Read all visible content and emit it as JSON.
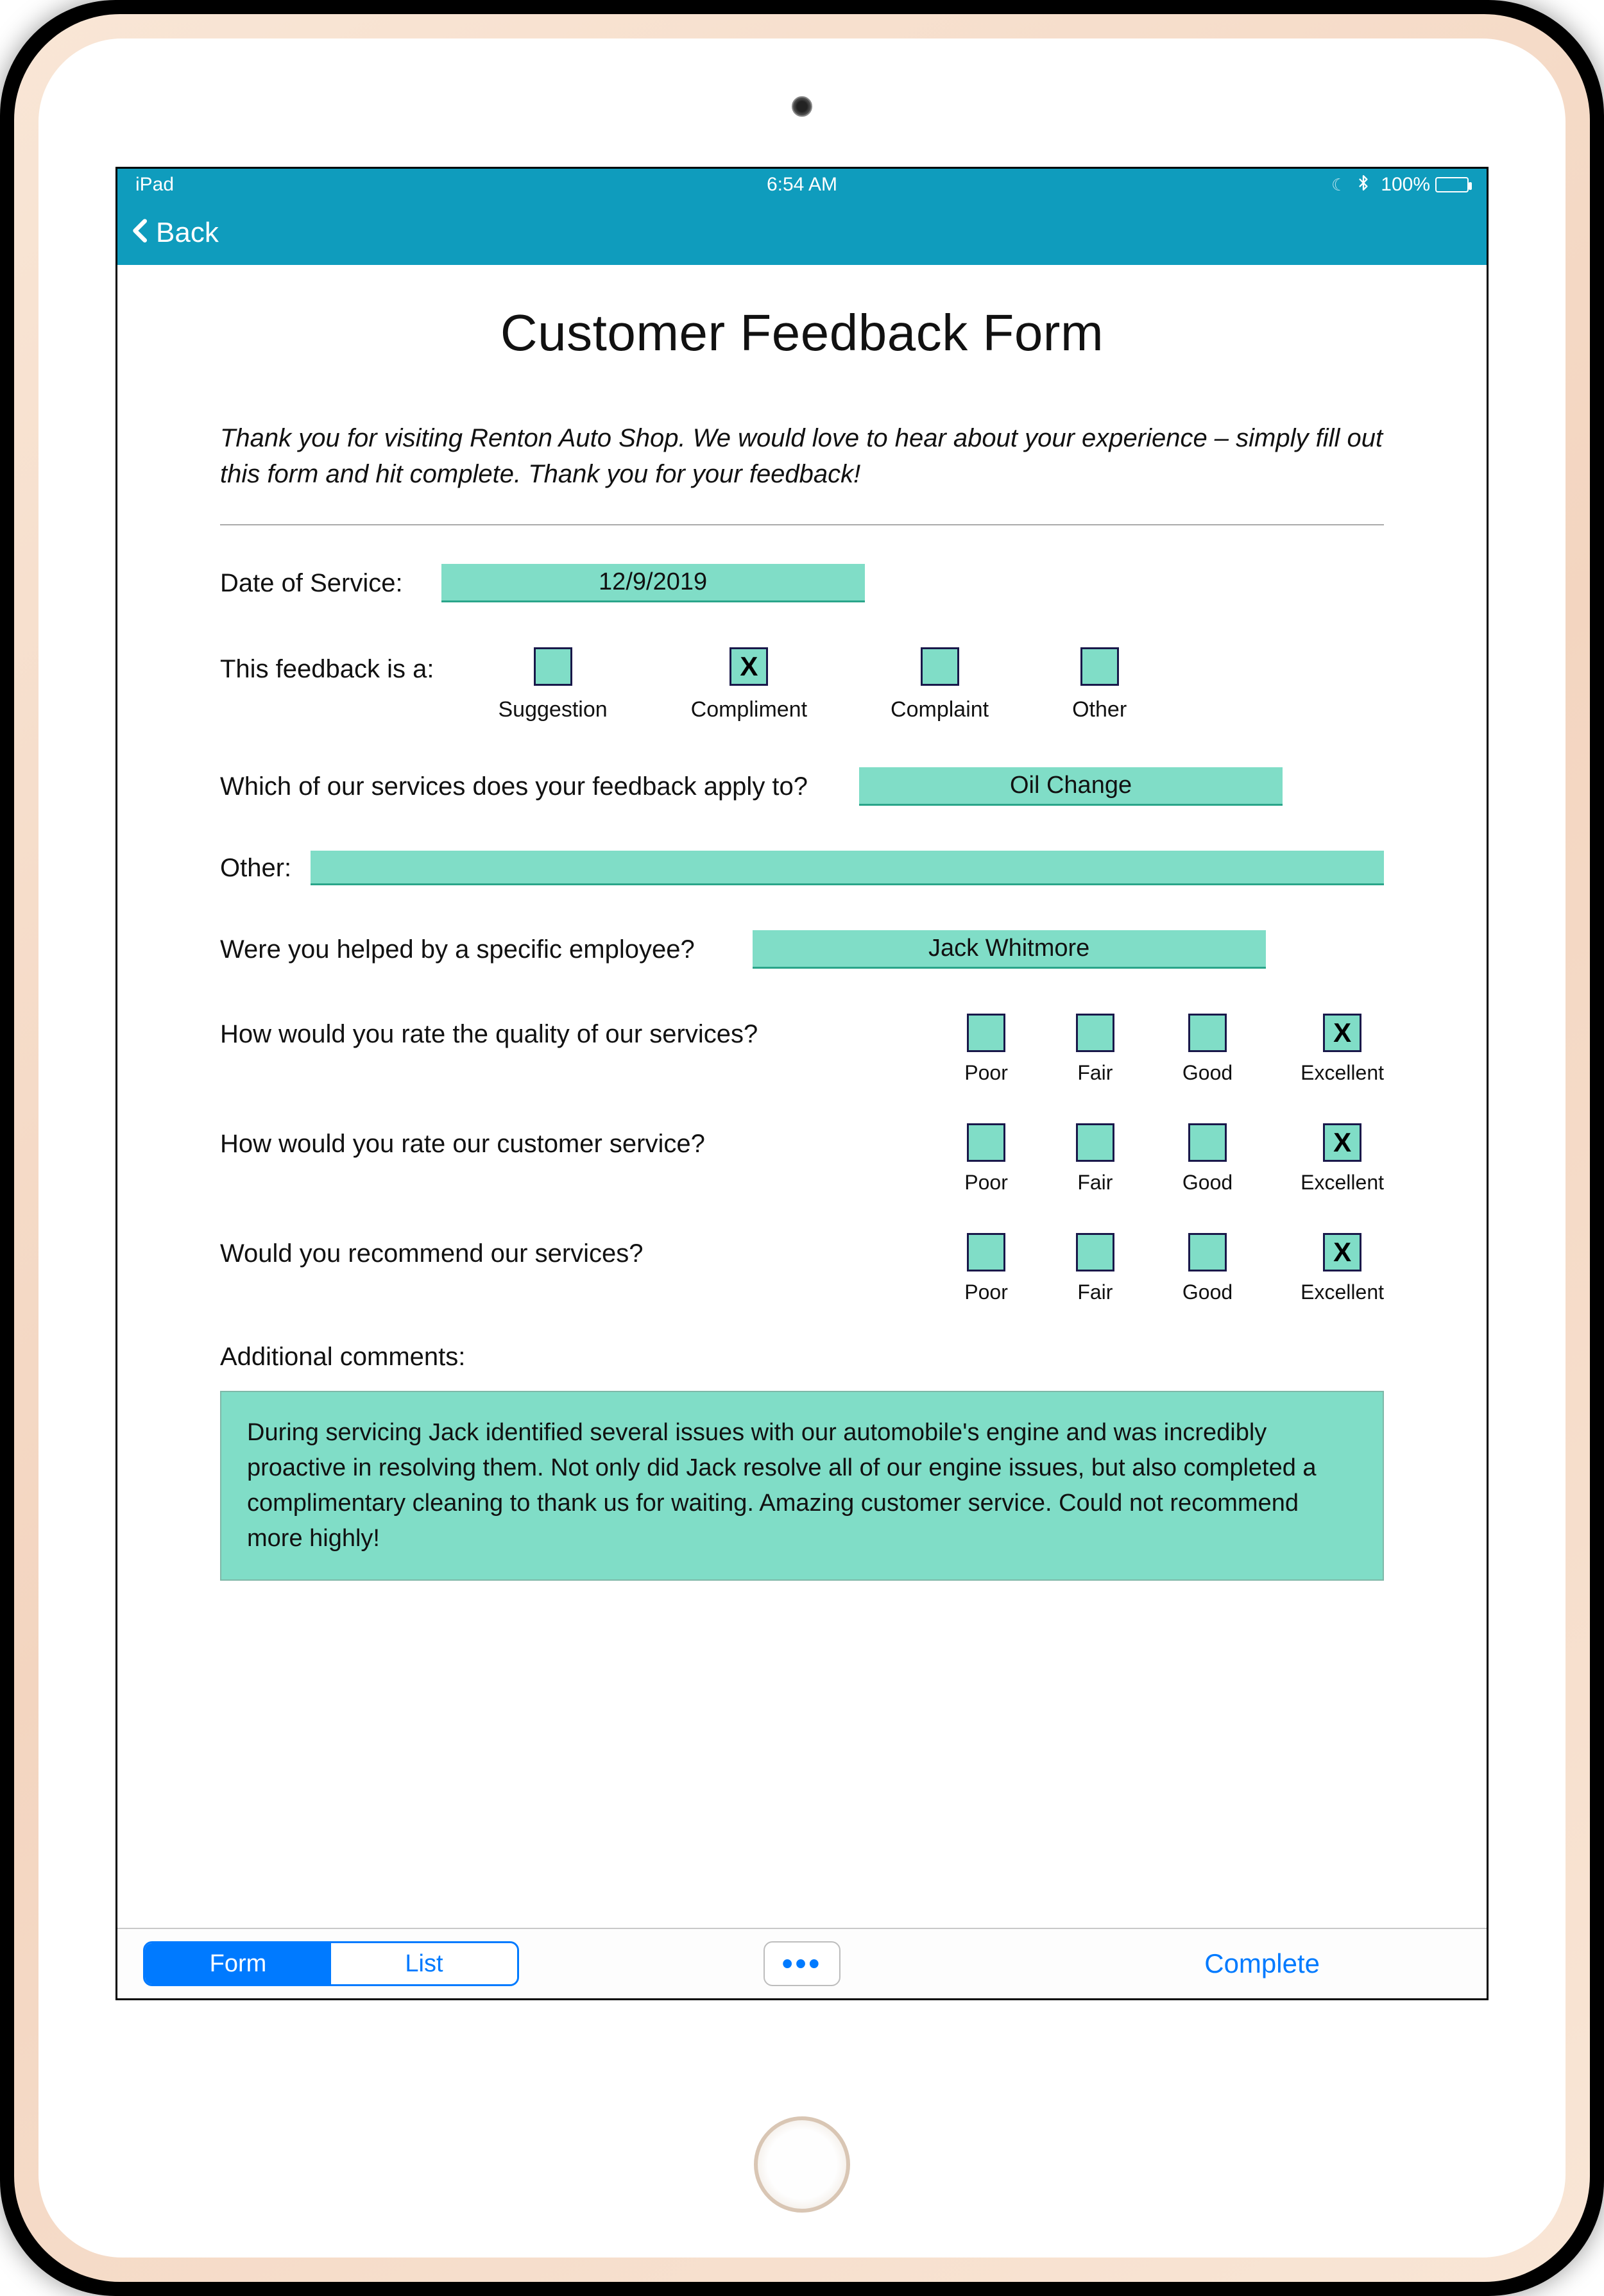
{
  "status": {
    "device": "iPad",
    "time": "6:54 AM",
    "battery": "100%"
  },
  "nav": {
    "back": "Back"
  },
  "page": {
    "title": "Customer Feedback Form",
    "intro": "Thank you for visiting Renton Auto Shop. We would love to hear about your experience – simply fill out this form and hit complete. Thank you for your feedback!"
  },
  "form": {
    "date_label": "Date of Service:",
    "date_value": "12/9/2019",
    "type_label": "This feedback is a:",
    "type_options": [
      "Suggestion",
      "Compliment",
      "Complaint",
      "Other"
    ],
    "type_selected": 1,
    "service_label": "Which of our services does your feedback apply to?",
    "service_value": "Oil Change",
    "other_label": "Other:",
    "other_value": "",
    "employee_label": "Were you helped by a specific employee?",
    "employee_value": "Jack Whitmore",
    "rating_scale": [
      "Poor",
      "Fair",
      "Good",
      "Excellent"
    ],
    "ratings": [
      {
        "q": "How would you rate the quality of our services?",
        "selected": 3
      },
      {
        "q": "How would you rate our customer service?",
        "selected": 3
      },
      {
        "q": "Would you recommend our services?",
        "selected": 3
      }
    ],
    "comments_label": "Additional comments:",
    "comments_value": "During servicing Jack identified several issues with our automobile's engine and was incredibly proactive in resolving them. Not only did Jack resolve all of our engine issues, but also completed a complimentary cleaning to thank us for waiting. Amazing customer service. Could not recommend more highly!"
  },
  "toolbar": {
    "seg1": "Form",
    "seg2": "List",
    "more": "•••",
    "complete": "Complete"
  }
}
